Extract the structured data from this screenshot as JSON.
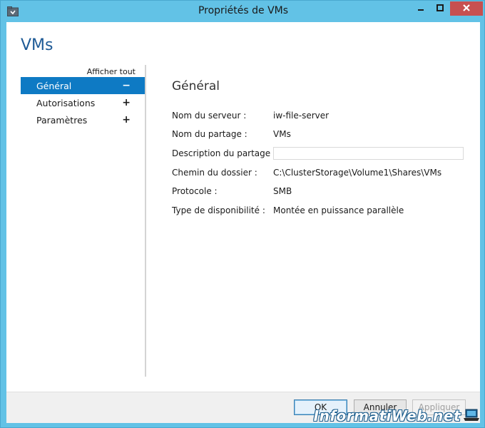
{
  "window": {
    "title": "Propriétés de VMs"
  },
  "page": {
    "title": "VMs"
  },
  "nav": {
    "show_all": "Afficher tout",
    "items": [
      {
        "label": "Général",
        "sign": "−",
        "active": true
      },
      {
        "label": "Autorisations",
        "sign": "+",
        "active": false
      },
      {
        "label": "Paramètres",
        "sign": "+",
        "active": false
      }
    ]
  },
  "section": {
    "title": "Général",
    "properties": [
      {
        "label": "Nom du serveur :",
        "value": "iw-file-server"
      },
      {
        "label": "Nom du partage :",
        "value": "VMs"
      },
      {
        "label": "Description du partage :",
        "value": ""
      },
      {
        "label": "Chemin du dossier :",
        "value": "C:\\ClusterStorage\\Volume1\\Shares\\VMs"
      },
      {
        "label": "Protocole :",
        "value": "SMB"
      },
      {
        "label": "Type de disponibilité :",
        "value": "Montée en puissance parallèle"
      }
    ]
  },
  "buttons": {
    "ok": "OK",
    "cancel": "Annuler",
    "apply": "Appliquer"
  },
  "watermark": {
    "text": "InformatiWeb.net"
  },
  "colors": {
    "titlebar": "#62c2e6",
    "accent": "#0e7ac4",
    "page_title": "#1e5a96",
    "close_button": "#c75050"
  }
}
